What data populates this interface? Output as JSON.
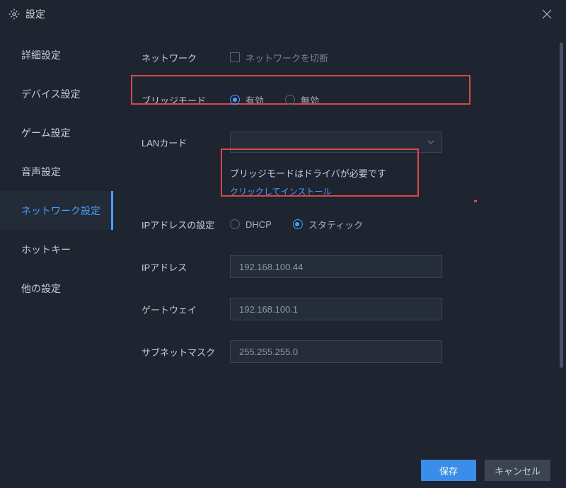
{
  "title": "設定",
  "sidebar": {
    "items": [
      {
        "label": "詳細設定"
      },
      {
        "label": "デバイス設定"
      },
      {
        "label": "ゲーム設定"
      },
      {
        "label": "音声設定"
      },
      {
        "label": "ネットワーク設定"
      },
      {
        "label": "ホットキー"
      },
      {
        "label": "他の設定"
      }
    ],
    "active_index": 4
  },
  "form": {
    "network_label": "ネットワーク",
    "network_disconnect": "ネットワークを切断",
    "bridge_label": "ブリッジモード",
    "bridge_enabled": "有効",
    "bridge_disabled": "無効",
    "bridge_selected": "enabled",
    "lan_label": "LANカード",
    "lan_value": "",
    "driver_notice": "ブリッジモードはドライバが必要です",
    "driver_link": "クリックしてインストール",
    "ip_settings_label": "IPアドレスの設定",
    "ip_dhcp": "DHCP",
    "ip_static": "スタティック",
    "ip_mode_selected": "static",
    "ip_address_label": "IPアドレス",
    "ip_address_value": "192.168.100.44",
    "gateway_label": "ゲートウェイ",
    "gateway_value": "192.168.100.1",
    "subnet_label": "サブネットマスク",
    "subnet_value": "255.255.255.0"
  },
  "footer": {
    "save": "保存",
    "cancel": "キャンセル"
  }
}
